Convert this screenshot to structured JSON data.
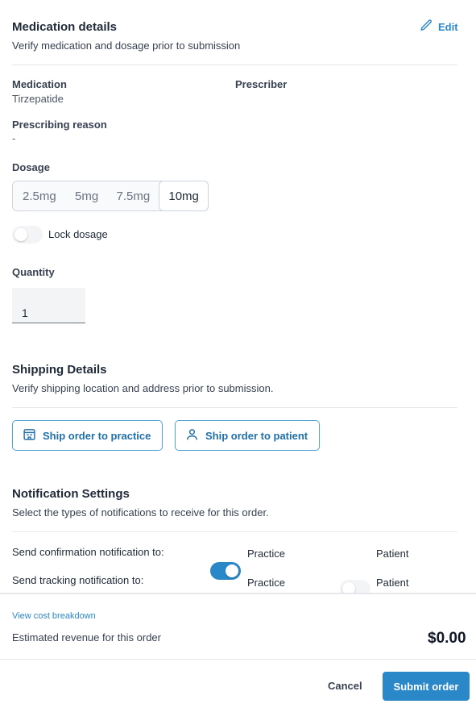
{
  "medication_details": {
    "title": "Medication details",
    "subtitle": "Verify medication and dosage prior to submission",
    "edit_label": "Edit",
    "medication_label": "Medication",
    "medication_value": "Tirzepatide",
    "prescriber_label": "Prescriber",
    "reason_label": "Prescribing reason",
    "reason_value": "-",
    "dosage_label": "Dosage",
    "dosage_options": [
      "2.5mg",
      "5mg",
      "7.5mg",
      "10mg"
    ],
    "dosage_selected": "10mg",
    "lock_label": "Lock dosage",
    "lock_enabled": false,
    "quantity_label": "Quantity",
    "quantity_value": "1"
  },
  "shipping": {
    "title": "Shipping Details",
    "subtitle": "Verify shipping location and address prior to submission.",
    "practice_button": "Ship order to practice",
    "patient_button": "Ship order to patient"
  },
  "notifications": {
    "title": "Notification Settings",
    "subtitle": "Select the types of notifications to receive for this order.",
    "rows": [
      {
        "label": "Send confirmation notification to:",
        "practice_label": "Practice",
        "practice_on": true,
        "patient_label": "Patient",
        "patient_on": false
      },
      {
        "label": "Send tracking notification to:",
        "practice_label": "Practice",
        "practice_on": true,
        "patient_label": "Patient",
        "patient_on": false
      }
    ]
  },
  "footer": {
    "cost_link": "View cost breakdown",
    "revenue_label": "Estimated revenue for this order",
    "revenue_value": "$0.00",
    "cancel_label": "Cancel",
    "submit_label": "Submit order"
  },
  "colors": {
    "accent": "#2b88c8",
    "border_accent": "#4fa3d6"
  }
}
